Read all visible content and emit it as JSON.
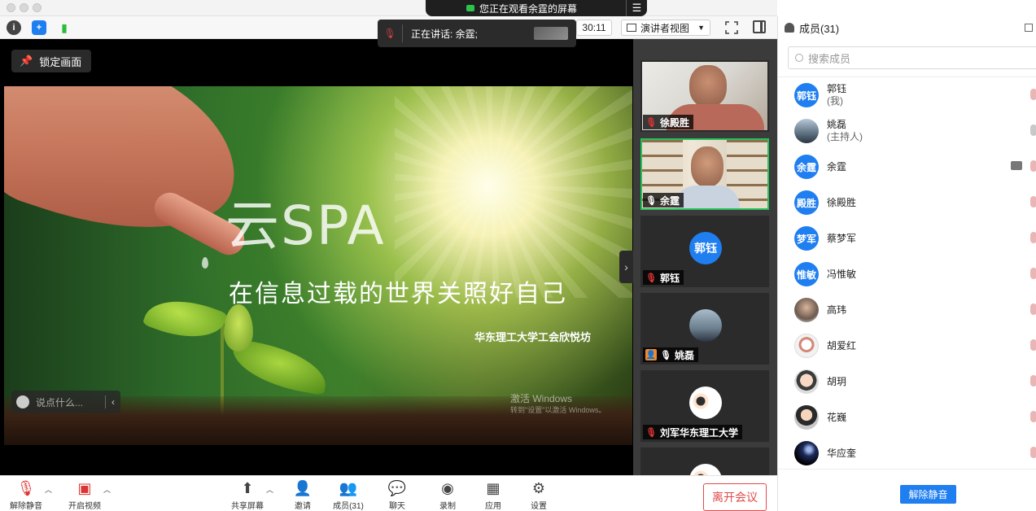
{
  "share_banner": {
    "text": "您正在观看余霆的屏幕",
    "menu_icon": "hamburger-icon"
  },
  "toolbar_top": {
    "timer": "30:11",
    "view_label": "演讲者视图"
  },
  "speaking": {
    "text": "正在讲话: 余霆;"
  },
  "stage": {
    "lock_label": "锁定画面",
    "slide": {
      "title": "云SPA",
      "subtitle": "在信息过载的世界关照好自己",
      "org": "华东理工大学工会欣悦坊",
      "watermark_line1": "激活 Windows",
      "watermark_line2": "转到\"设置\"以激活 Windows。"
    },
    "chat_placeholder": "说点什么..."
  },
  "video_tiles": [
    {
      "name": "徐殿胜",
      "type": "camera1",
      "mic": "muted"
    },
    {
      "name": "余霆",
      "type": "camera2",
      "mic": "on",
      "active": true
    },
    {
      "name": "郭钰",
      "type": "avatar",
      "avatar_text": "郭钰",
      "mic": "muted"
    },
    {
      "name": "姚磊",
      "type": "photo",
      "mic": "on",
      "host": true
    },
    {
      "name": "刘军华东理工大学",
      "type": "cartoon",
      "mic": "muted"
    }
  ],
  "bottom_toolbar": {
    "unmute": "解除静音",
    "start_video": "开启视频",
    "share": "共享屏幕",
    "invite": "邀请",
    "members": "成员(31)",
    "chat": "聊天",
    "record": "录制",
    "apps": "应用",
    "settings": "设置",
    "leave": "离开会议"
  },
  "panel": {
    "title": "成员(31)",
    "search_placeholder": "搜索成员",
    "participants": [
      {
        "avatar": "郭钰",
        "name": "郭钰",
        "sub": "(我)",
        "style": "blue",
        "mic": "muted"
      },
      {
        "avatar": "",
        "name": "姚磊",
        "sub": "(主持人)",
        "style": "photo1",
        "mic": "on"
      },
      {
        "avatar": "余霆",
        "name": "余霆",
        "sub": "",
        "style": "blue",
        "mic": "muted",
        "sharing": true
      },
      {
        "avatar": "殿胜",
        "name": "徐殿胜",
        "sub": "",
        "style": "blue",
        "mic": "muted"
      },
      {
        "avatar": "梦军",
        "name": "蔡梦军",
        "sub": "",
        "style": "blue",
        "mic": "muted"
      },
      {
        "avatar": "惟敏",
        "name": "冯惟敏",
        "sub": "",
        "style": "blue",
        "mic": "muted"
      },
      {
        "avatar": "",
        "name": "高玮",
        "sub": "",
        "style": "photo2",
        "mic": "muted"
      },
      {
        "avatar": "",
        "name": "胡爱红",
        "sub": "",
        "style": "photo3",
        "mic": "muted"
      },
      {
        "avatar": "",
        "name": "胡玥",
        "sub": "",
        "style": "photo4",
        "mic": "muted"
      },
      {
        "avatar": "",
        "name": "花巍",
        "sub": "",
        "style": "photo5",
        "mic": "muted"
      },
      {
        "avatar": "",
        "name": "华应奎",
        "sub": "",
        "style": "photo6",
        "mic": "muted"
      }
    ],
    "unmute_all": "解除静音"
  },
  "colors": {
    "accent": "#1f7ef0",
    "active_border": "#28c05a",
    "leave": "#e04a4a"
  }
}
